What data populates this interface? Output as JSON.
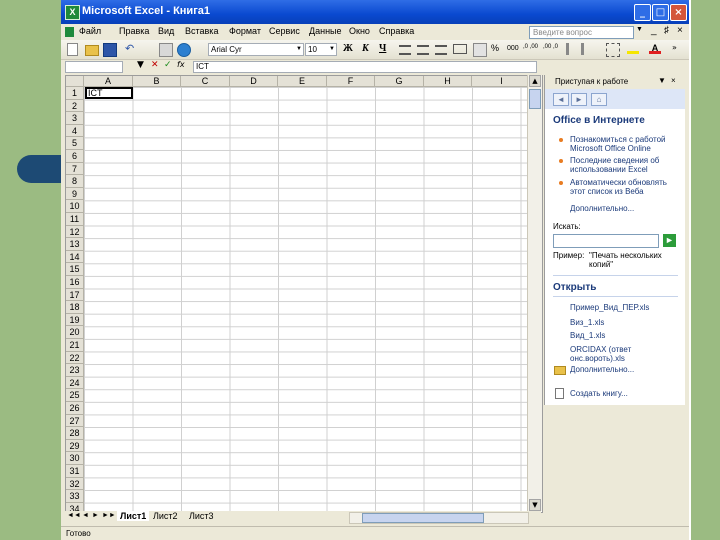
{
  "window": {
    "title": "Microsoft Excel - Книга1",
    "app_icon": "X",
    "controls": {
      "minimize": "_",
      "maximize": "□",
      "close": "×"
    }
  },
  "menu": {
    "items": [
      "Файл",
      "Правка",
      "Вид",
      "Вставка",
      "Формат",
      "Сервис",
      "Данные",
      "Окно",
      "Справка"
    ],
    "ask_placeholder": "Введите вопрос",
    "ask_dropdown": "▼",
    "doc_controls": [
      "_",
      "♯",
      "×"
    ]
  },
  "toolbar": {
    "font_name": "Arial Cyr",
    "font_size": "10",
    "bold": "Ж",
    "italic": "К",
    "underline": "Ч",
    "percent": "%",
    "thousands": "000",
    "dec_increase": ",0 ,00",
    "dec_decrease": ",00 ,0"
  },
  "formula_bar": {
    "name_box": "",
    "cancel": "✕",
    "enter": "✓",
    "fx": "fx",
    "value": "ICT"
  },
  "sheet": {
    "columns": [
      "A",
      "B",
      "C",
      "D",
      "E",
      "F",
      "G",
      "H",
      "I"
    ],
    "rows": [
      "1",
      "2",
      "3",
      "4",
      "5",
      "6",
      "7",
      "8",
      "9",
      "10",
      "11",
      "12",
      "13",
      "14",
      "15",
      "16",
      "17",
      "18",
      "19",
      "20",
      "21",
      "22",
      "23",
      "24",
      "25",
      "26",
      "27",
      "28",
      "29",
      "30",
      "31",
      "32",
      "33",
      "34"
    ],
    "active_cell": "A1",
    "cell_a1": "ICT"
  },
  "tabs": {
    "nav": [
      "◄◄",
      "◄",
      "►",
      "►►"
    ],
    "sheets": [
      "Лист1",
      "Лист2",
      "Лист3"
    ],
    "active": "Лист1"
  },
  "status": {
    "text": "Готово"
  },
  "taskpane": {
    "title": "Приступая к работе",
    "nav_buttons": [
      "◄",
      "►",
      "⌂"
    ],
    "office_online": "Office в Интернете",
    "links": [
      "Познакомиться с работой Microsoft Office Online",
      "Последние сведения об использовании Excel",
      "Автоматически обновлять этот список из Веба"
    ],
    "more": "Дополнительно...",
    "search_label": "Искать:",
    "search_go": "►",
    "example_label": "Пример:",
    "example_text": "\"Печать нескольких копий\"",
    "open_title": "Открыть",
    "files": [
      "Пример_Вид_ПЕР.xls",
      "Виз_1.xls",
      "Вид_1.xls",
      "ORCIDAX (ответ онс.вороть).xls"
    ],
    "open_more": "Дополнительно...",
    "create_book": "Создать книгу..."
  }
}
